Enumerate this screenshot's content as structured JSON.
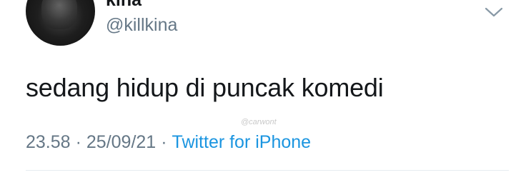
{
  "tweet": {
    "display_name": "kina",
    "handle": "@killkina",
    "text": "sedang hidup di puncak komedi",
    "time": "23.58",
    "separator": "·",
    "date": "25/09/21",
    "source": "Twitter for iPhone",
    "watermark": "@carwont"
  },
  "icons": {
    "menu": "chevron-down-icon"
  },
  "colors": {
    "text_primary": "#14171a",
    "text_secondary": "#657786",
    "link": "#1b95e0",
    "divider": "#e6ecf0"
  }
}
